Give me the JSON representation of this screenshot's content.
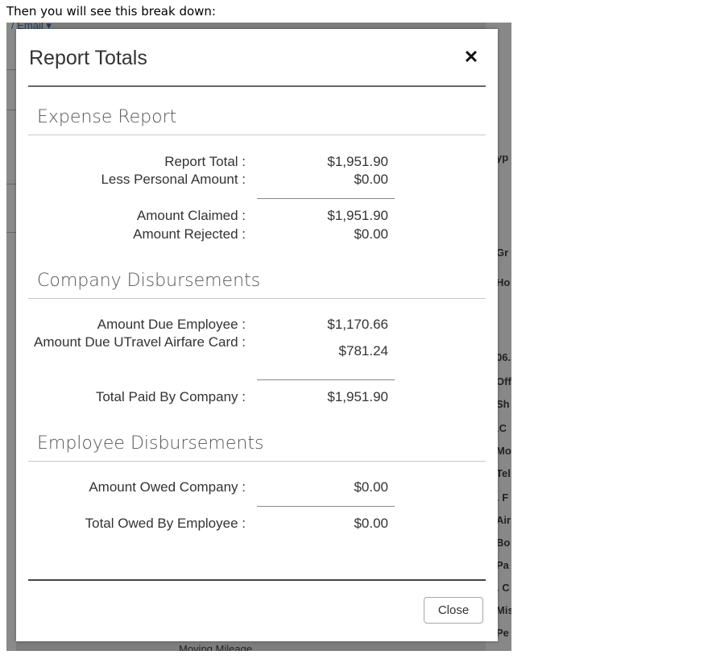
{
  "intro_text": "Then you will see this break down:",
  "background": {
    "top_fragment": "/ Email ▾",
    "right_fragments": [
      "yp",
      "Gr",
      "Ho",
      "06.",
      "Off",
      "Sh",
      ".C",
      "Mo",
      "Tel",
      ". F",
      "Air",
      "Bo",
      "Pa",
      ". C",
      "Mis",
      "Pe"
    ],
    "bottom_fragment": "Moving Mileage"
  },
  "modal": {
    "title": "Report Totals",
    "close_icon": "close-icon",
    "close_button_label": "Close"
  },
  "expense_report": {
    "title": "Expense Report",
    "rows": [
      {
        "label": "Report Total :",
        "value": "$1,951.90"
      },
      {
        "label": "Less Personal Amount :",
        "value": "$0.00"
      },
      {
        "label": "Amount Claimed :",
        "value": "$1,951.90"
      },
      {
        "label": "Amount Rejected :",
        "value": "$0.00"
      }
    ]
  },
  "company_disbursements": {
    "title": "Company Disbursements",
    "rows": [
      {
        "label": "Amount Due Employee :",
        "value": "$1,170.66"
      },
      {
        "label": "Amount Due UTravel Airfare Card :",
        "value": "$781.24"
      },
      {
        "label": "Total Paid By Company :",
        "value": "$1,951.90"
      }
    ]
  },
  "employee_disbursements": {
    "title": "Employee Disbursements",
    "rows": [
      {
        "label": "Amount Owed Company :",
        "value": "$0.00"
      },
      {
        "label": "Total Owed By Employee :",
        "value": "$0.00"
      }
    ]
  }
}
